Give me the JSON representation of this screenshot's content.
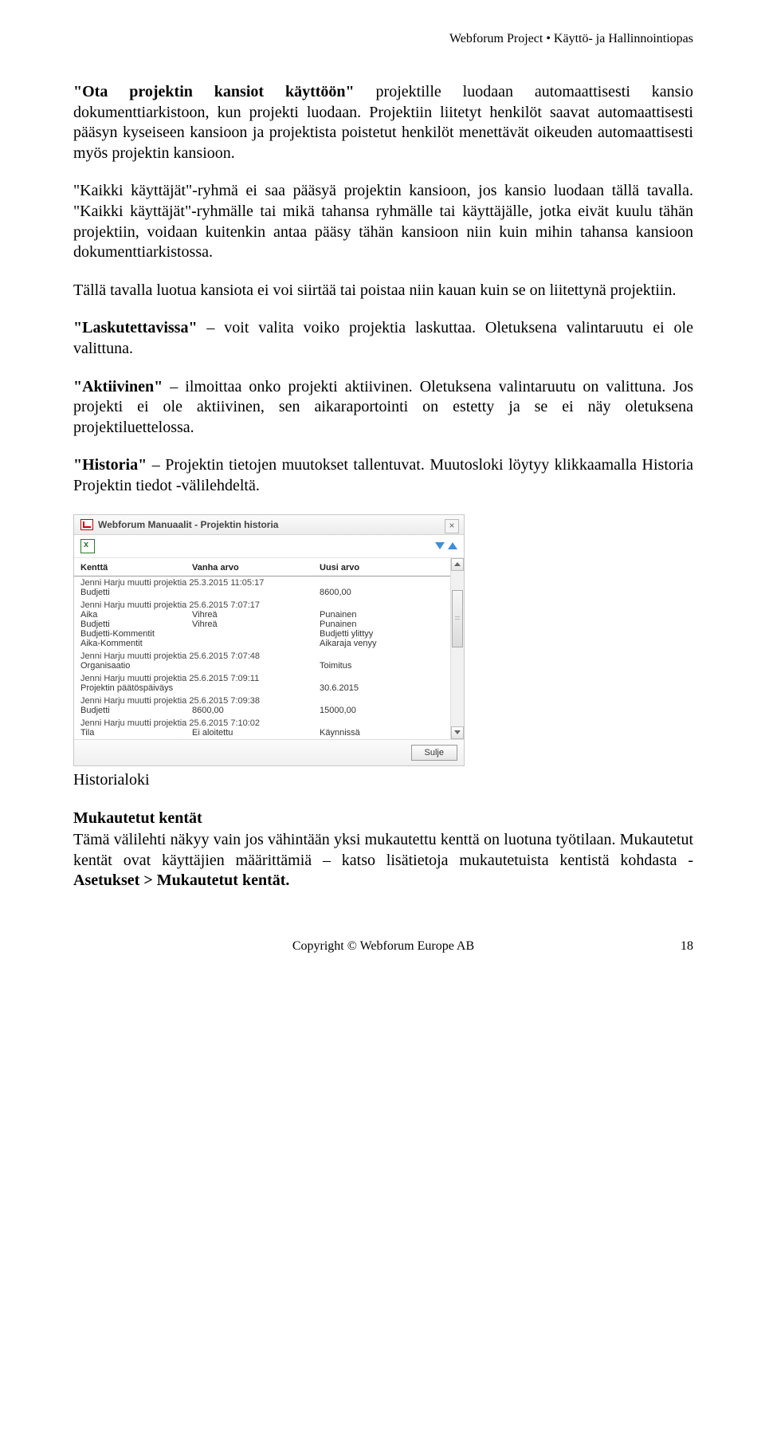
{
  "header": "Webforum Project • Käyttö- ja Hallinnointiopas",
  "p1_bold": "\"Ota projektin kansiot käyttöön\"",
  "p1_rest": " projektille luodaan automaattisesti kansio dokumenttiarkistoon, kun projekti luodaan. Projektiin liitetyt henkilöt saavat automaattisesti pääsyn kyseiseen kansioon ja projektista poistetut henkilöt menettävät oikeuden automaattisesti myös projektin kansioon.",
  "p2": "\"Kaikki käyttäjät\"-ryhmä ei saa pääsyä projektin kansioon, jos kansio luodaan tällä tavalla. \"Kaikki käyttäjät\"-ryhmälle tai mikä tahansa ryhmälle tai käyttäjälle, jotka eivät kuulu tähän projektiin, voidaan kuitenkin antaa pääsy tähän kansioon niin kuin mihin tahansa kansioon dokumenttiarkistossa.",
  "p3": "Tällä tavalla luotua kansiota ei voi siirtää tai poistaa niin kauan kuin se on liitettynä projektiin.",
  "p4_bold": "\"Laskutettavissa\"",
  "p4_rest": " – voit valita voiko projektia laskuttaa. Oletuksena valintaruutu ei ole valittuna.",
  "p5_bold": "\"Aktiivinen\"",
  "p5_rest": " – ilmoittaa onko projekti aktiivinen. Oletuksena valintaruutu on valittuna. Jos projekti ei ole aktiivinen, sen aikaraportointi on estetty ja se ei näy oletuksena projektiluettelossa.",
  "p6_bold": "\"Historia\"",
  "p6_rest": " – Projektin tietojen muutokset tallentuvat. Muutosloki löytyy klikkaamalla Historia Projektin tiedot -välilehdeltä.",
  "caption": "Historialoki",
  "p7_bold": "Mukautetut kentät",
  "p8_a": "Tämä välilehti näkyy vain jos vähintään yksi mukautettu kenttä on luotuna työtilaan. Mukautetut kentät ovat käyttäjien määrittämiä – katso lisätietoja mukautetuista kentistä kohdasta - ",
  "p8_b": "Asetukset > Mukautetut kentät.",
  "footer_center": "Copyright © Webforum Europe AB",
  "footer_page": "18",
  "dialog": {
    "title": "Webforum Manuaalit - Projektin historia",
    "col_field": "Kenttä",
    "col_old": "Vanha arvo",
    "col_new": "Uusi arvo",
    "close_label": "Sulje",
    "entries": [
      {
        "meta": "Jenni Harju muutti projektia 25.3.2015 11:05:17",
        "rows": [
          {
            "f": "Budjetti",
            "o": "",
            "n": "8600,00"
          }
        ]
      },
      {
        "meta": "Jenni Harju muutti projektia 25.6.2015 7:07:17",
        "rows": [
          {
            "f": "Aika",
            "o": "Vihreä",
            "n": "Punainen"
          },
          {
            "f": "Budjetti",
            "o": "Vihreä",
            "n": "Punainen"
          },
          {
            "f": "Budjetti-Kommentit",
            "o": "",
            "n": "Budjetti ylittyy"
          },
          {
            "f": "Aika-Kommentit",
            "o": "",
            "n": "Aikaraja venyy"
          }
        ]
      },
      {
        "meta": "Jenni Harju muutti projektia 25.6.2015 7:07:48",
        "rows": [
          {
            "f": "Organisaatio",
            "o": "",
            "n": "Toimitus"
          }
        ]
      },
      {
        "meta": "Jenni Harju muutti projektia 25.6.2015 7:09:11",
        "rows": [
          {
            "f": "Projektin päätöspäiväys",
            "o": "",
            "n": "30.6.2015"
          }
        ]
      },
      {
        "meta": "Jenni Harju muutti projektia 25.6.2015 7:09:38",
        "rows": [
          {
            "f": "Budjetti",
            "o": "8600,00",
            "n": "15000,00"
          }
        ]
      },
      {
        "meta": "Jenni Harju muutti projektia 25.6.2015 7:10:02",
        "rows": [
          {
            "f": "Tila",
            "o": "Ei aloitettu",
            "n": "Käynnissä"
          }
        ]
      }
    ]
  }
}
